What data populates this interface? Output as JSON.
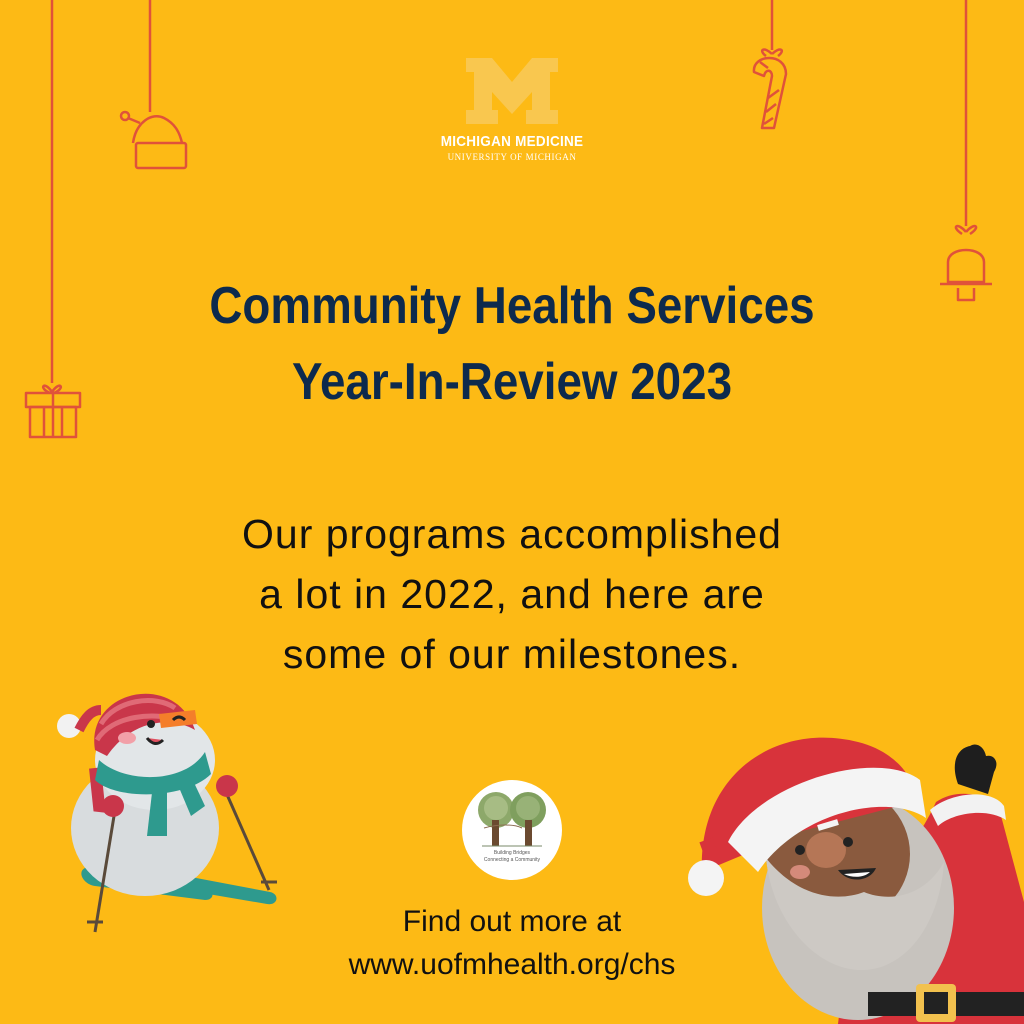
{
  "brand": {
    "name": "MICHIGAN MEDICINE",
    "sub": "UNIVERSITY OF MICHIGAN"
  },
  "title": {
    "line1": "Community Health Services",
    "line2": "Year-In-Review 2023"
  },
  "intro": {
    "line1": "Our programs accomplished",
    "line2": "a lot in 2022, and here are",
    "line3": "some of our milestones."
  },
  "partner": {
    "line1": "Building Bridges",
    "line2": "Connecting a Community"
  },
  "footer": {
    "line1": "Find out more at",
    "line2": "www.uofmhealth.org/chs"
  },
  "colors": {
    "background": "#FDBA15",
    "title": "#0D2A4D",
    "ornament": "#E0523A",
    "body_text": "#111111"
  },
  "icons": [
    "block-m-logo",
    "hat-ornament-icon",
    "candy-cane-icon",
    "bell-icon",
    "gift-icon",
    "snowman-illustration",
    "santa-illustration",
    "tree-logo"
  ]
}
